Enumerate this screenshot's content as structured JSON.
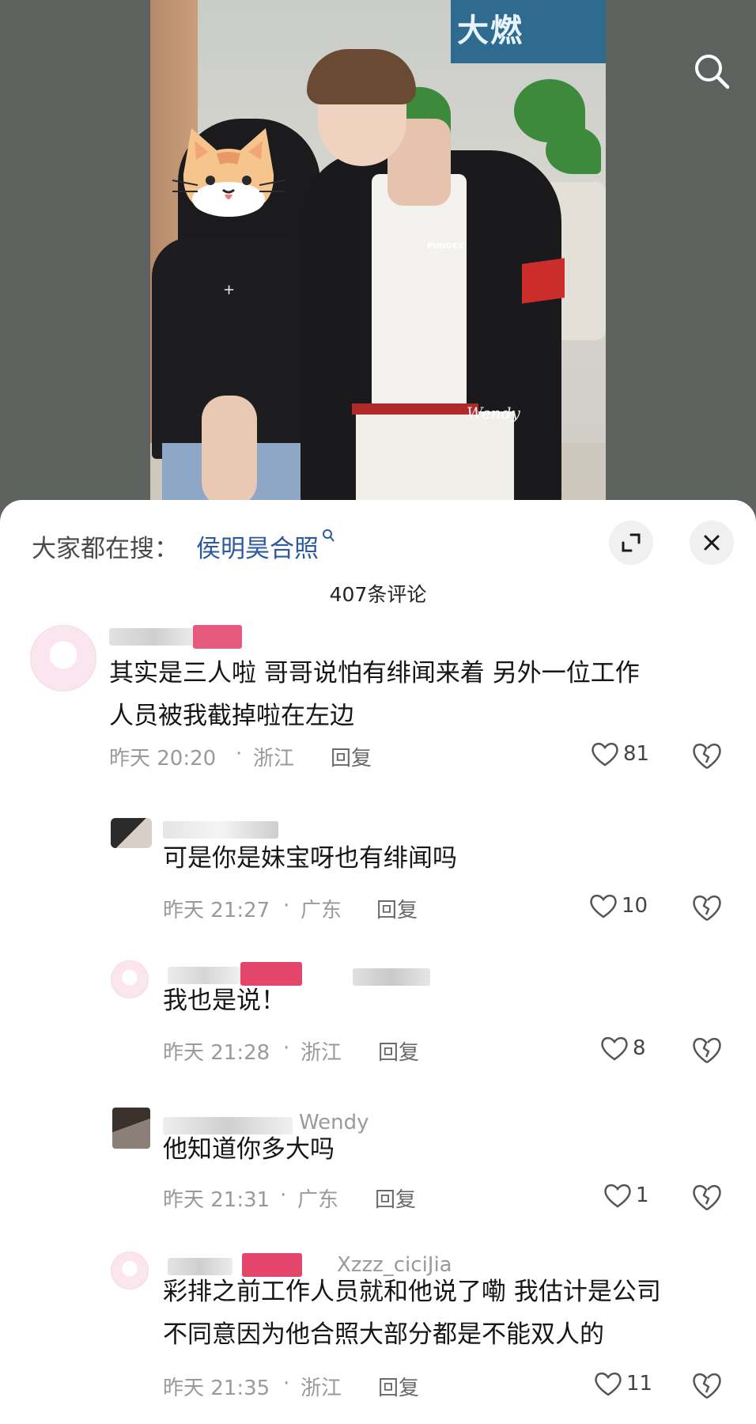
{
  "photo": {
    "banner_text": "大燃",
    "jacket_logo": "PUNDEX",
    "watermark": "Wendy"
  },
  "sheet": {
    "trend_label": "大家都在搜：",
    "trend_query": "侯明昊合照",
    "comment_count": "407条评论"
  },
  "comments": [
    {
      "text_lines": [
        "其实是三人啦 哥哥说怕有绯闻来着 另外一位工作",
        "人员被我截掉啦在左边"
      ],
      "time": "昨天 20:20",
      "location": "浙江",
      "reply": "回复",
      "likes": "81"
    },
    {
      "text_lines": [
        "可是你是妹宝呀也有绯闻吗"
      ],
      "time": "昨天 21:27",
      "location": "广东",
      "reply": "回复",
      "likes": "10"
    },
    {
      "text_lines": [
        "我也是说！"
      ],
      "time": "昨天 21:28",
      "location": "浙江",
      "reply": "回复",
      "likes": "8"
    },
    {
      "name_suffix": "Wendy",
      "text_lines": [
        "他知道你多大吗"
      ],
      "time": "昨天 21:31",
      "location": "广东",
      "reply": "回复",
      "likes": "1"
    },
    {
      "name_suffix": "Xzzz_ciciJia",
      "text_lines": [
        "彩排之前工作人员就和他说了嘞 我估计是公司",
        "不同意因为他合照大部分都是不能双人的"
      ],
      "time": "昨天 21:35",
      "location": "浙江",
      "reply": "回复",
      "likes": "11"
    }
  ],
  "separator": "·",
  "icons": {
    "search": "search-icon",
    "expand": "expand-icon",
    "close": "close-icon",
    "like": "heart-icon",
    "dislike": "broken-heart-icon",
    "avatar": "melody-avatar"
  },
  "colors": {
    "link": "#2c5aa0",
    "meta": "#9a9a9a",
    "sheet_bg": "#ffffff",
    "page_bg": "#5f6360"
  }
}
